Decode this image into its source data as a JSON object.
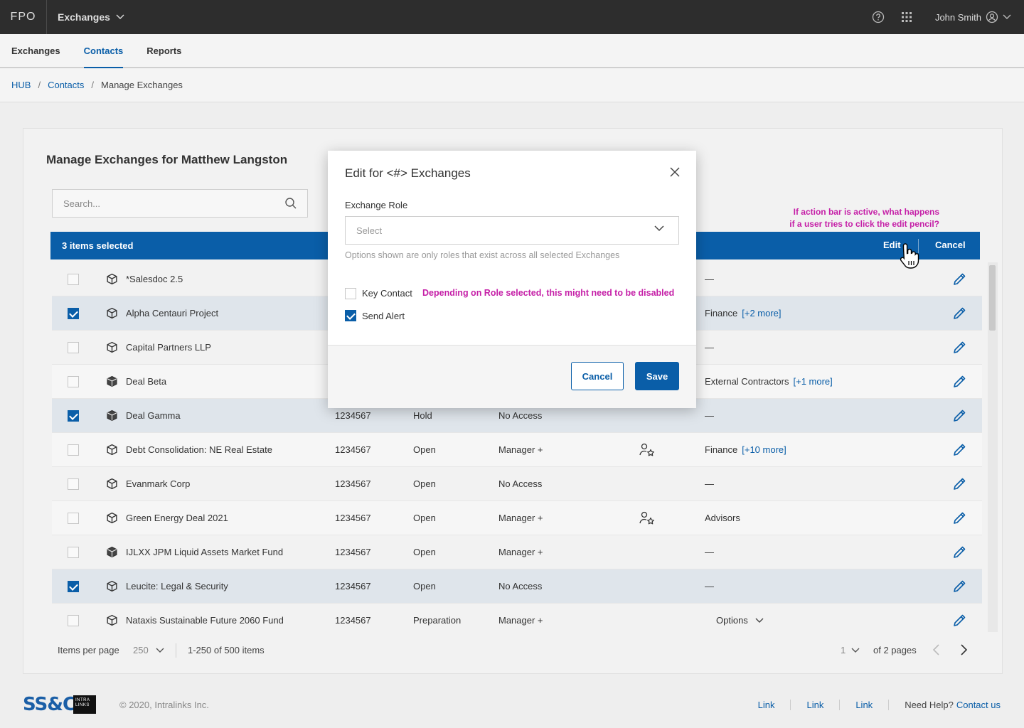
{
  "topbar": {
    "logo": "FPO",
    "app_switch": "Exchanges",
    "user_name": "John Smith",
    "icons": [
      "help-circle-icon",
      "grid-apps-icon",
      "user-circle-icon",
      "chevron-down-icon"
    ]
  },
  "nav": {
    "tabs": [
      {
        "label": "Exchanges",
        "active": false
      },
      {
        "label": "Contacts",
        "active": true
      },
      {
        "label": "Reports",
        "active": false
      }
    ]
  },
  "breadcrumb": {
    "items": [
      "HUB",
      "Contacts"
    ],
    "current": "Manage Exchanges"
  },
  "card": {
    "title": "Manage Exchanges for Matthew Langston",
    "search_placeholder": "Search..."
  },
  "actionbar": {
    "selected_text": "3 items selected",
    "edit_label": "Edit",
    "cancel_label": "Cancel"
  },
  "rows": [
    {
      "name": "*Salesdoc 2.5",
      "checked": false,
      "id": "",
      "status": "",
      "access": "",
      "key": false,
      "groups": "—",
      "more": "",
      "solid": false
    },
    {
      "name": "Alpha Centauri Project",
      "checked": true,
      "id": "",
      "status": "",
      "access": "",
      "key": false,
      "groups": "Finance",
      "more": "[+2 more]",
      "solid": false
    },
    {
      "name": "Capital Partners LLP",
      "checked": false,
      "id": "",
      "status": "",
      "access": "",
      "key": false,
      "groups": "—",
      "more": "",
      "solid": false
    },
    {
      "name": "Deal Beta",
      "checked": false,
      "id": "",
      "status": "",
      "access": "",
      "key": false,
      "groups": "External Contractors",
      "more": "[+1 more]",
      "solid": true
    },
    {
      "name": "Deal Gamma",
      "checked": true,
      "id": "1234567",
      "status": "Hold",
      "access": "No Access",
      "key": false,
      "groups": "—",
      "more": "",
      "solid": true
    },
    {
      "name": "Debt Consolidation: NE Real Estate",
      "checked": false,
      "id": "1234567",
      "status": "Open",
      "access": "Manager +",
      "key": true,
      "groups": "Finance",
      "more": "[+10 more]",
      "solid": false
    },
    {
      "name": "Evanmark Corp",
      "checked": false,
      "id": "1234567",
      "status": "Open",
      "access": "No Access",
      "key": false,
      "groups": "—",
      "more": "",
      "solid": false
    },
    {
      "name": "Green Energy Deal 2021",
      "checked": false,
      "id": "1234567",
      "status": "Open",
      "access": "Manager +",
      "key": true,
      "groups": "Advisors",
      "more": "",
      "solid": false
    },
    {
      "name": "IJLXX JPM Liquid Assets Market Fund",
      "checked": false,
      "id": "1234567",
      "status": "Open",
      "access": "Manager +",
      "key": false,
      "groups": "—",
      "more": "",
      "solid": true
    },
    {
      "name": "Leucite: Legal & Security",
      "checked": true,
      "id": "1234567",
      "status": "Open",
      "access": "No Access",
      "key": false,
      "groups": "—",
      "more": "",
      "solid": false
    },
    {
      "name": "Nataxis Sustainable Future 2060 Fund",
      "checked": false,
      "id": "1234567",
      "status": "Preparation",
      "access": "Manager +",
      "key": false,
      "groups": "",
      "more": "",
      "options": "Options",
      "solid": false
    }
  ],
  "annotation_pencil": "If action bar is active, what happens if a user tries to click the edit pencil?",
  "pager": {
    "items_per_page_label": "Items per page",
    "items_per_page_value": "250",
    "range": "1-250 of 500 items",
    "page": "1",
    "of_pages": "of 2 pages"
  },
  "footer": {
    "brand": "SS&C",
    "intralinks": "INTRA LINKS",
    "copyright": "© 2020, Intralinks Inc.",
    "links": [
      "Link",
      "Link",
      "Link"
    ],
    "help_text": "Need Help?",
    "contact_link": "Contact us"
  },
  "modal": {
    "title": "Edit for <#> Exchanges",
    "role_label": "Exchange Role",
    "role_placeholder": "Select",
    "role_help": "Options shown are only roles that exist across all selected Exchanges",
    "key_contact_label": "Key Contact",
    "key_contact_checked": false,
    "send_alert_label": "Send Alert",
    "send_alert_checked": true,
    "note": "Depending on Role selected, this might need to be disabled",
    "cancel_label": "Cancel",
    "save_label": "Save"
  },
  "colors": {
    "brand_blue": "#0a5ea8",
    "topbar": "#2d2d2d",
    "annotation_magenta": "#c51fa7",
    "selected_row": "#dfe5eb"
  }
}
